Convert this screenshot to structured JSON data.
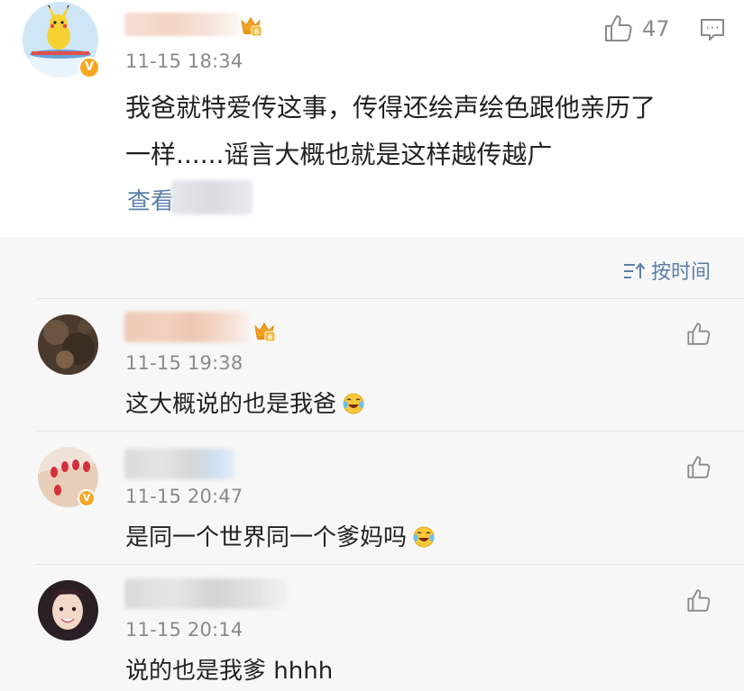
{
  "main_comment": {
    "timestamp": "11-15 18:34",
    "text_line1": "我爸就特爱传这事，传得还绘声绘色跟他亲历了",
    "text_line2": "一样......谣言大概也就是这样越传越广",
    "like_count": "47",
    "view_more_label": "查看"
  },
  "sort": {
    "label": "按时间"
  },
  "replies": [
    {
      "timestamp": "11-15 19:38",
      "text": "这大概说的也是我爸",
      "emoji": "laugh-cry-icon"
    },
    {
      "timestamp": "11-15 20:47",
      "text": "是同一个世界同一个爹妈吗",
      "emoji": "laugh-cry-icon"
    },
    {
      "timestamp": "11-15 20:14",
      "text": "说的也是我爹 hhhh"
    }
  ],
  "badge_letter": "V",
  "colors": {
    "link": "#5b7faa",
    "vip": "#f5a623",
    "meta": "#8a8a8a"
  }
}
